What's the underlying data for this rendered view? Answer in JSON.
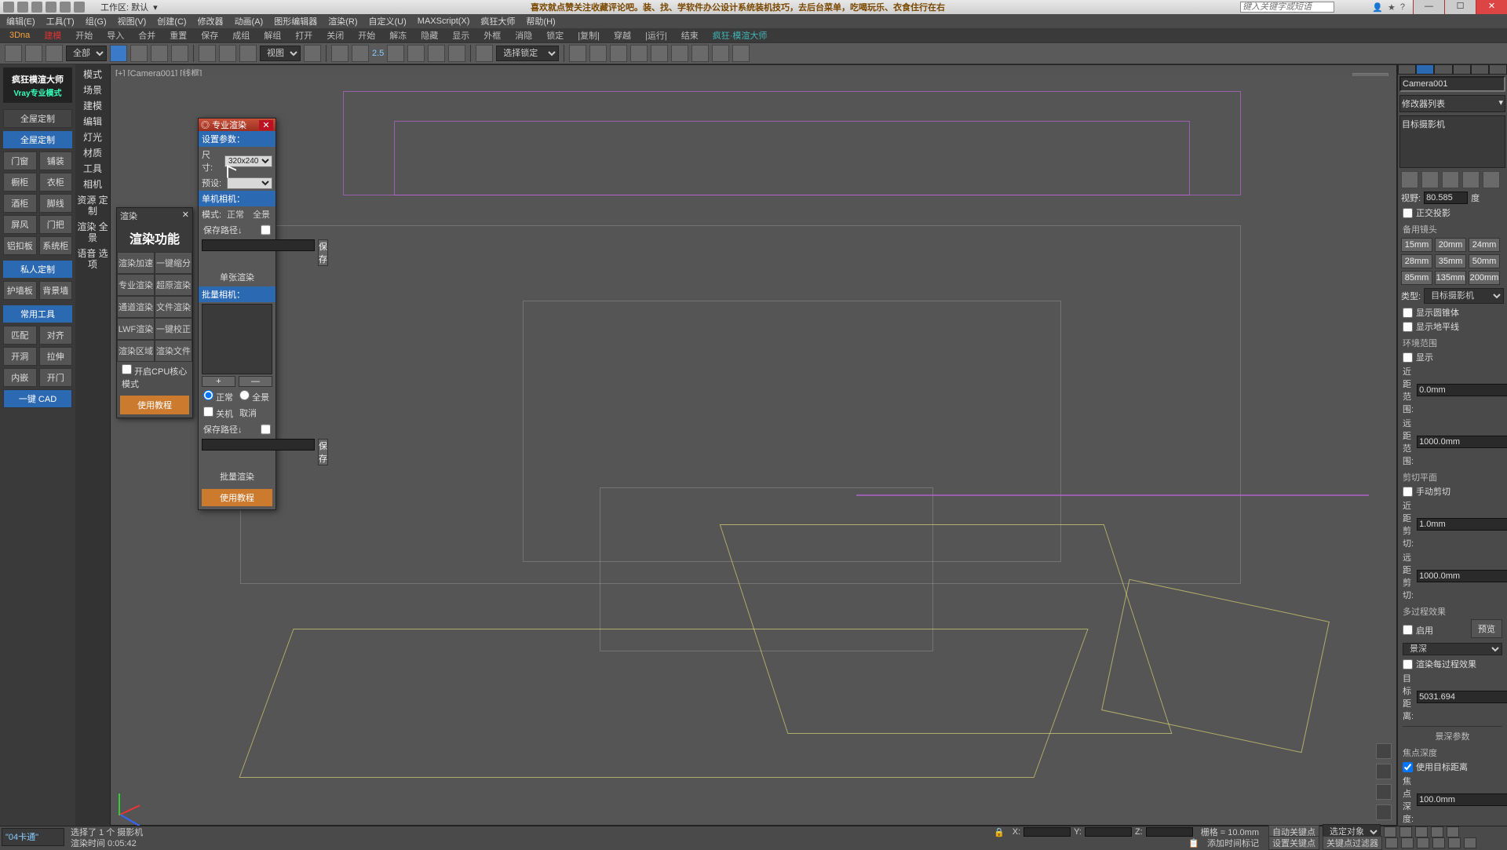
{
  "title_banner": "喜欢就点赞关注收藏评论吧。装、找、学软件办公设计系统装机技巧，去后台菜单，吃喝玩乐、衣食住行在右",
  "workspace_label": "工作区: 默认",
  "search_placeholder": "键入关键字或短语",
  "menus": [
    "编辑(E)",
    "工具(T)",
    "组(G)",
    "视图(V)",
    "创建(C)",
    "修改器",
    "动画(A)",
    "图形编辑器",
    "渲染(R)",
    "自定义(U)",
    "MAXScript(X)",
    "疯狂大师",
    "帮助(H)"
  ],
  "ribbon": [
    "3Dna",
    "建模",
    "开始",
    "导入",
    "合并",
    "重置",
    "保存",
    "成组",
    "解组",
    "打开",
    "关闭",
    "开始",
    "解冻",
    "隐藏",
    "显示",
    "外框",
    "消隐",
    "锁定",
    "|复制|",
    "穿越",
    "|运行|",
    "结束",
    "疯狂·模渲大师"
  ],
  "toolbar_dropdowns": {
    "scope": "全部",
    "view": "视图",
    "snap": "选择锁定"
  },
  "left": {
    "logo_big": "疯狂模渲大师",
    "logo_small": "Vray专业模式",
    "hdr1": "全屋定制",
    "btns1": [
      [
        "门窗",
        "铺装"
      ],
      [
        "橱柜",
        "衣柜"
      ],
      [
        "酒柜",
        "脚线"
      ],
      [
        "屏风",
        "门把"
      ],
      [
        "铝扣板",
        "系统柜"
      ]
    ],
    "hdr2": "私人定制",
    "btns2": [
      [
        "护墙板",
        "背景墙"
      ]
    ],
    "hdr3": "常用工具",
    "btns3": [
      [
        "匹配",
        "对齐"
      ],
      [
        "开洞",
        "拉伸"
      ],
      [
        "内嵌",
        "开门"
      ]
    ],
    "hdr4": "一键 CAD",
    "rail": [
      "模式",
      "场景",
      "建模",
      "编辑",
      "灯光",
      "材质",
      "工具",
      "相机",
      "资源 定制",
      "渲染 全景",
      "语音 选项"
    ]
  },
  "viewport_label": "[+] [Camera001] [线框]",
  "panel1": {
    "title": "渲染",
    "header": "渲染功能",
    "rows": [
      [
        "渲染加速",
        "一键缩分"
      ],
      [
        "专业渲染",
        "超原渲染"
      ],
      [
        "通道渲染",
        "文件渲染"
      ],
      [
        "LWF渲染",
        "一键校正"
      ],
      [
        "渲染区域",
        "渲染文件"
      ]
    ],
    "cpu": "开启CPU核心模式",
    "tutorial": "使用教程"
  },
  "panel2": {
    "title": "专业渲染",
    "section_params": "设置参数：",
    "size_label": "尺寸:",
    "size_value": "320x240",
    "preset_label": "预设:",
    "section_single": "单机相机：",
    "mode_label": "模式:",
    "mode_normal": "正常",
    "mode_pano": "全景",
    "save_path": "保存路径↓",
    "save": "保存",
    "render_single": "单张渲染",
    "section_batch": "批量相机：",
    "plus": "+",
    "minus": "—",
    "radio_normal": "正常",
    "radio_pano": "全景",
    "chk_off": "关机",
    "cancel": "取消",
    "render_batch": "批量渲染",
    "tutorial": "使用教程"
  },
  "right": {
    "object": "Camera001",
    "mod": "修改器列表",
    "stack": "目标摄影机",
    "fov_label": "视野:",
    "fov": "80.585",
    "deg": "度",
    "ortho": "正交投影",
    "lenses_label": "备用镜头",
    "lenses": [
      "15mm",
      "20mm",
      "24mm",
      "28mm",
      "35mm",
      "50mm",
      "85mm",
      "135mm",
      "200mm"
    ],
    "type_label": "类型:",
    "type": "目标摄影机",
    "show_cone": "显示圆锥体",
    "show_horizon": "显示地平线",
    "env_label": "环境范围",
    "show": "显示",
    "near_label": "近距范围:",
    "near": "0.0mm",
    "far_label": "远距范围:",
    "far": "1000.0mm",
    "clip_label": "剪切平面",
    "manual": "手动剪切",
    "cnear_label": "近距剪切:",
    "cnear": "1.0mm",
    "cfar_label": "远距剪切:",
    "cfar": "1000.0mm",
    "multi_label": "多过程效果",
    "enable": "启用",
    "preview": "预览",
    "effect": "景深",
    "render_per": "渲染每过程效果",
    "target_label": "目标距离:",
    "target": "5031.694",
    "dof_section": "景深参数",
    "dof_depth": "焦点深度",
    "dof_use": "使用目标距离",
    "dof_focal_label": "焦点深度:",
    "dof_focal": "100.0mm"
  },
  "status": {
    "layer": "\"04卡通\"",
    "selection": "选择了 1 个 摄影机",
    "render_time": "渲染时间  0:05:42",
    "x": "X:",
    "y": "Y:",
    "z": "Z:",
    "grid": "栅格 = 10.0mm",
    "autokey": "自动关键点",
    "selobj": "选定对象",
    "setkey": "设置关键点",
    "keyfilter": "关键点过滤器",
    "addmark": "添加时间标记"
  }
}
